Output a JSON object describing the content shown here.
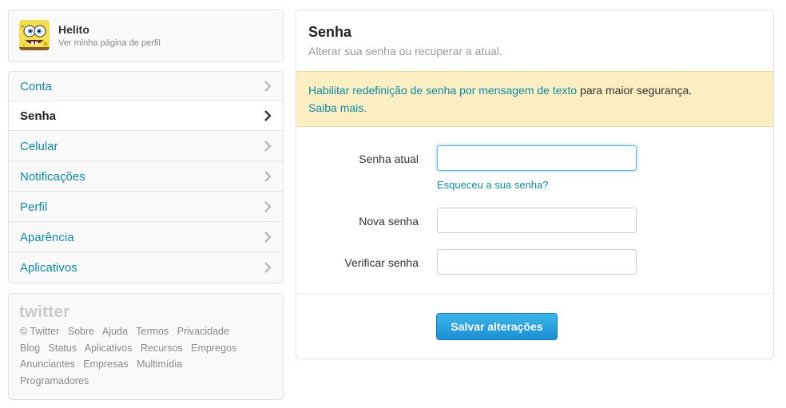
{
  "profile": {
    "name": "Helito",
    "link": "Ver minha página de perfil"
  },
  "nav": {
    "items": [
      {
        "label": "Conta"
      },
      {
        "label": "Senha"
      },
      {
        "label": "Celular"
      },
      {
        "label": "Notificações"
      },
      {
        "label": "Perfil"
      },
      {
        "label": "Aparência"
      },
      {
        "label": "Aplicativos"
      }
    ],
    "active": "Senha"
  },
  "footer": {
    "logo": "twitter",
    "lines": [
      [
        "© Twitter",
        "Sobre",
        "Ajuda",
        "Termos",
        "Privacidade"
      ],
      [
        "Blog",
        "Status",
        "Aplicativos",
        "Recursos",
        "Empregos"
      ],
      [
        "Anunciantes",
        "Empresas",
        "Multimídia"
      ],
      [
        "Programadores"
      ]
    ]
  },
  "main": {
    "title": "Senha",
    "subtitle": "Alterar sua senha ou recuperar a atual.",
    "notice": {
      "link_text": "Habilitar redefinição de senha por mensagem de texto",
      "plain_text": " para maior segurança.",
      "more_link": "Saiba mais."
    },
    "fields": {
      "current_label": "Senha atual",
      "forgot_link": "Esqueceu a sua senha?",
      "new_label": "Nova senha",
      "verify_label": "Verificar senha"
    },
    "save_label": "Salvar alterações"
  },
  "colors": {
    "link": "#0b8ca8",
    "notice_bg": "#fbeec2",
    "button": "#1c8fd4"
  },
  "icons": {
    "nav_item": "chevron-right-icon",
    "avatar": "spongebob-avatar"
  }
}
